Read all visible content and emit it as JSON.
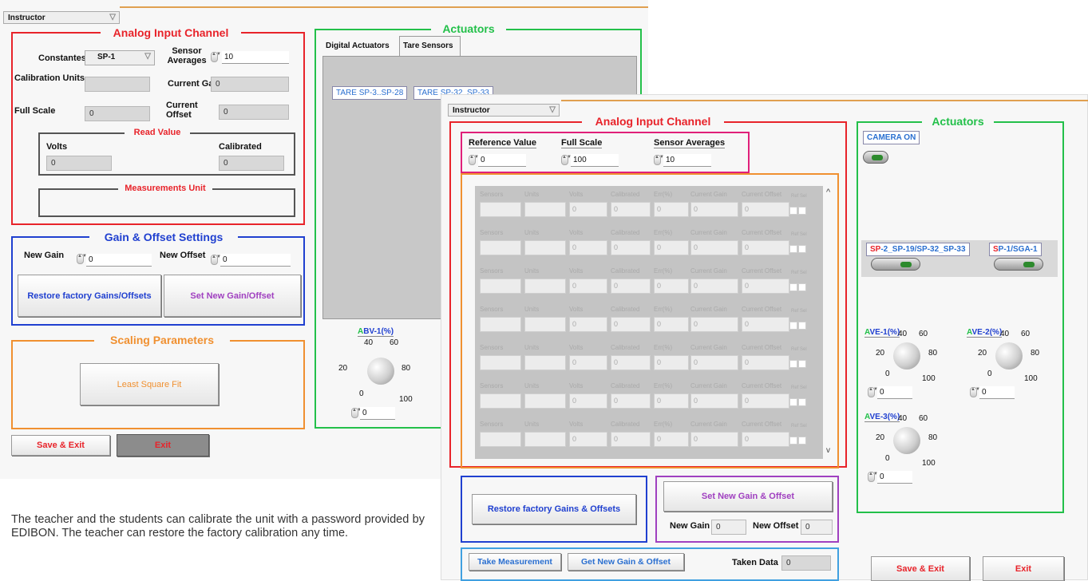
{
  "w1": {
    "user_select": "Instructor",
    "analog_title": "Analog Input Channel",
    "constantes_label": "Constantes",
    "constantes_value": "SP-1",
    "sensor_averages_label": "Sensor Averages",
    "sensor_averages_value": "10",
    "calibration_units_label": "Calibration Units",
    "current_gain_label": "Current Gain",
    "current_gain_value": "0",
    "full_scale_label": "Full Scale",
    "full_scale_value": "0",
    "current_offset_label": "Current Offset",
    "current_offset_value": "0",
    "read_value_title": "Read Value",
    "volts_label": "Volts",
    "volts_value": "0",
    "calibrated_label": "Calibrated",
    "calibrated_value": "0",
    "measurements_unit_title": "Measurements Unit",
    "gain_offset_title": "Gain & Offset Settings",
    "new_gain_label": "New Gain",
    "new_gain_value": "0",
    "new_offset_label": "New Offset",
    "new_offset_value": "0",
    "restore_button": "Restore factory Gains/Offsets",
    "set_new_button": "Set New Gain/Offset",
    "scaling_title": "Scaling Parameters",
    "least_square_button": "Least Square Fit",
    "save_exit_button": "Save & Exit",
    "exit_button": "Exit",
    "actuators_title": "Actuators",
    "tab_digital": "Digital Actuators",
    "tab_tare": "Tare Sensors",
    "tare_btn_1": "TARE SP-3..SP-28",
    "tare_btn_2": "TARE SP-32_SP-33",
    "abv_label_a": "A",
    "abv_label_rest": "BV-1(%)",
    "abv_value": "0"
  },
  "w2": {
    "user_select": "Instructor",
    "analog_title": "Analog Input Channel",
    "reference_value_label": "Reference Value",
    "reference_value": "0",
    "full_scale_label": "Full Scale",
    "full_scale_value": "100",
    "sensor_averages_label": "Sensor Averages",
    "sensor_averages_value": "10",
    "table_headers": [
      "Sensors",
      "Units",
      "Volts",
      "Calibrated",
      "Err(%)",
      "Current Gain",
      "Current Offset"
    ],
    "row_cell_value": "0",
    "ref_label": "Ref",
    "sel_label": "Sel",
    "restore_button": "Restore factory Gains & Offsets",
    "set_new_button": "Set New Gain & Offset",
    "new_gain_label": "New Gain",
    "new_gain_value": "0",
    "new_offset_label": "New Offset",
    "new_offset_value": "0",
    "take_measurement_button": "Take Measurement",
    "get_new_button": "Get New Gain & Offset",
    "taken_data_label": "Taken Data",
    "taken_data_value": "0",
    "actuators_title": "Actuators",
    "camera_label": "CAMERA ON",
    "sp_group_red": "SP",
    "sp_group_rest": "-2_SP-19/SP-32_SP-33",
    "sp1_red": "S",
    "sp1_rest": "P-1/SGA-1",
    "ave1_a": "A",
    "ave1_rest": "VE-1(%)",
    "ave2_a": "A",
    "ave2_rest": "VE-2(%)",
    "ave3_a": "A",
    "ave3_rest": "VE-3(%)",
    "save_exit_button": "Save & Exit",
    "exit_button": "Exit"
  },
  "knob_scale": {
    "t40": "40",
    "t60": "60",
    "t20": "20",
    "t80": "80",
    "t0": "0",
    "t100": "100"
  },
  "caption": "The teacher and the students can calibrate the unit with a password provided by EDIBON. The teacher can restore the factory calibration any time.",
  "colors": {
    "red": "#e8232a",
    "blue": "#2040d0",
    "orange": "#f09030",
    "green": "#23c04a",
    "purple": "#a040c0",
    "magenta": "#e0207a"
  }
}
